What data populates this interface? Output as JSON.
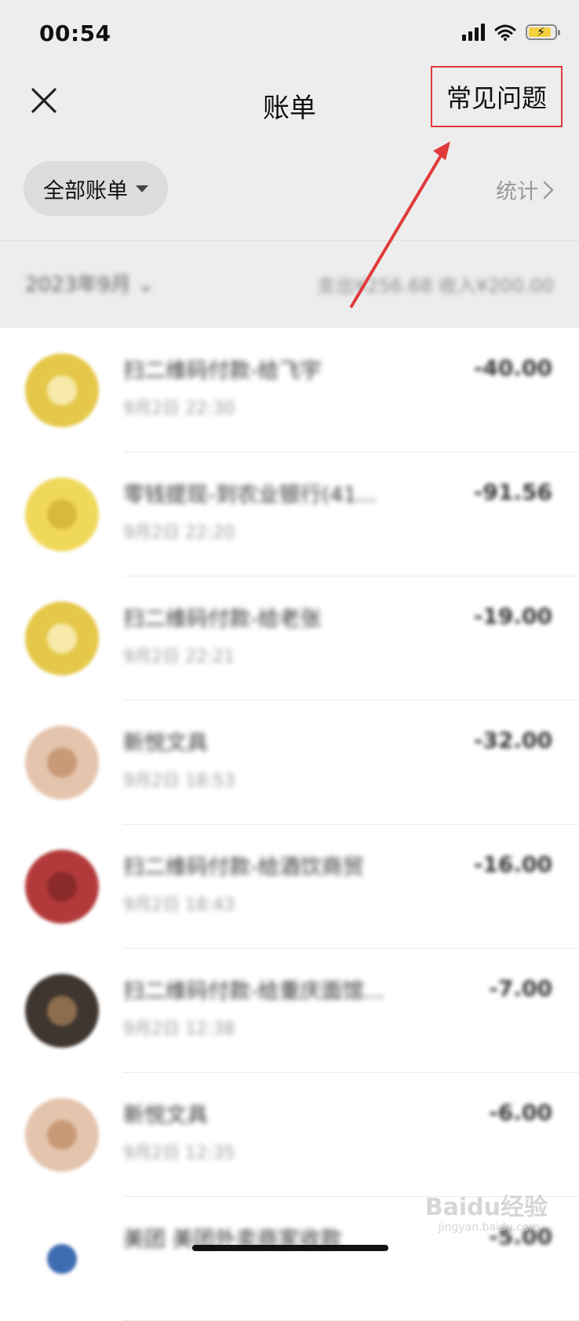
{
  "status_bar": {
    "time": "00:54"
  },
  "nav": {
    "title": "账单",
    "faq_label": "常见问题"
  },
  "filter": {
    "label": "全部账单",
    "stats_label": "统计"
  },
  "month": {
    "label": "2023年9月",
    "summary": "支出¥256.68 收入¥200.00"
  },
  "transactions": [
    {
      "title": "扫二维码付款-给飞宇",
      "time": "9月2日 22:30",
      "amount": "-40.00",
      "avatar_color": "#e5c84a",
      "inner_color": "#f7eaa8"
    },
    {
      "title": "零钱提现-到农业银行(41...",
      "time": "9月2日 22:20",
      "amount": "-91.56",
      "avatar_color": "#f0d85a",
      "inner_color": "#d9b93a"
    },
    {
      "title": "扫二维码付款-给老张",
      "time": "9月2日 22:21",
      "amount": "-19.00",
      "avatar_color": "#e5c84a",
      "inner_color": "#f7eaa8"
    },
    {
      "title": "新悦文具",
      "time": "9月2日 18:53",
      "amount": "-32.00",
      "avatar_color": "#e4c4ad",
      "inner_color": "#c99a77"
    },
    {
      "title": "扫二维码付款-给酒饮商贸",
      "time": "9月2日 18:43",
      "amount": "-16.00",
      "avatar_color": "#b33a3a",
      "inner_color": "#8a2a2a"
    },
    {
      "title": "扫二维码付款-给重庆面馆...",
      "time": "9月2日 12:38",
      "amount": "-7.00",
      "avatar_color": "#3f3630",
      "inner_color": "#8c6e4e"
    },
    {
      "title": "新悦文具",
      "time": "9月2日 12:35",
      "amount": "-6.00",
      "avatar_color": "#e4c4ad",
      "inner_color": "#c99a77"
    },
    {
      "title": "美团 美团外卖商家收款",
      "time": "",
      "amount": "-5.00",
      "avatar_color": "#ffffff",
      "inner_color": "#3f6db3"
    }
  ],
  "watermark": {
    "brand": "Baidu经验",
    "url": "jingyan.baidu.com"
  },
  "annotation_color": "#e03a3a"
}
